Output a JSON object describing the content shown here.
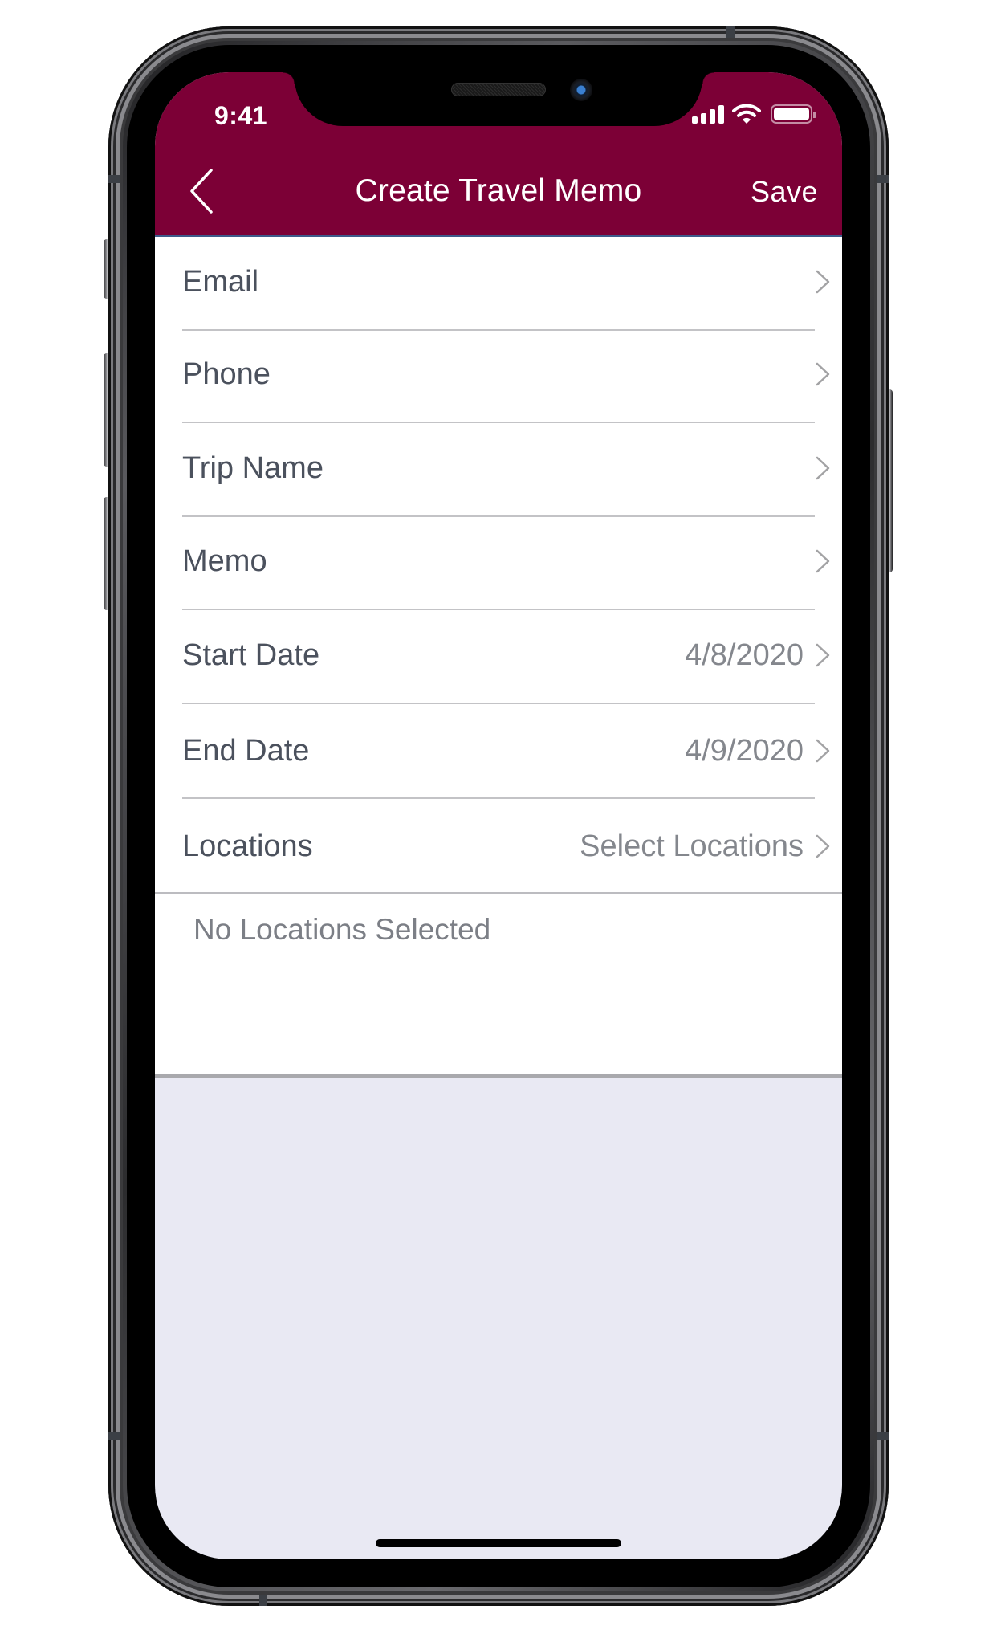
{
  "status_bar": {
    "time": "9:41",
    "icons": [
      "cellular-signal-icon",
      "wifi-icon",
      "battery-icon"
    ]
  },
  "nav": {
    "back_icon": "chevron-left-icon",
    "title": "Create Travel Memo",
    "save_label": "Save"
  },
  "form": {
    "rows": [
      {
        "label": "Email",
        "value": ""
      },
      {
        "label": "Phone",
        "value": ""
      },
      {
        "label": "Trip Name",
        "value": ""
      },
      {
        "label": "Memo",
        "value": ""
      },
      {
        "label": "Start Date",
        "value": "4/8/2020"
      },
      {
        "label": "End Date",
        "value": "4/9/2020"
      },
      {
        "label": "Locations",
        "value": "Select Locations"
      }
    ],
    "locations_empty_text": "No Locations Selected"
  },
  "colors": {
    "nav_background": "#7c0036",
    "label_text": "#4b515d",
    "value_text": "#84878d",
    "background": "#e9e9f3"
  }
}
